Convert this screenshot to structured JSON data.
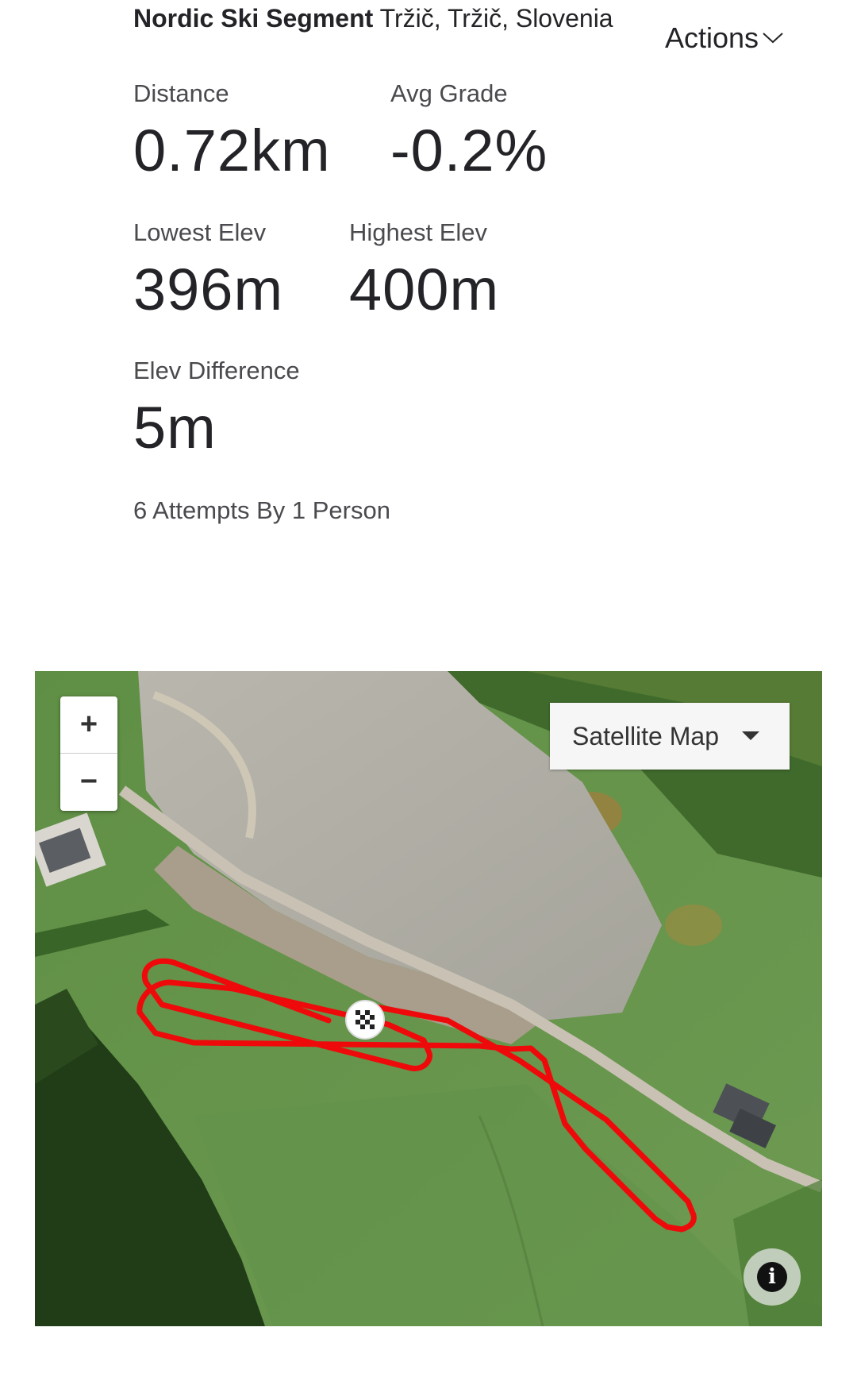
{
  "header": {
    "segment_name": "Nordic Ski Segment",
    "location": "Tržič, Tržič, Slovenia",
    "actions_label": "Actions",
    "actions_icon": "chevron-down-icon"
  },
  "stats": {
    "distance": {
      "label": "Distance",
      "value": "0.72km"
    },
    "avg_grade": {
      "label": "Avg Grade",
      "value": "-0.2%"
    },
    "lowest_elev": {
      "label": "Lowest Elev",
      "value": "396m"
    },
    "highest_elev": {
      "label": "Highest Elev",
      "value": "400m"
    },
    "elev_difference": {
      "label": "Elev Difference",
      "value": "5m"
    }
  },
  "attempts_text": "6 Attempts By 1 Person",
  "map": {
    "zoom_in_label": "+",
    "zoom_out_label": "−",
    "map_type_label": "Satellite Map",
    "map_type_icon": "caret-down-icon",
    "info_icon": "info-icon",
    "info_glyph": "i",
    "start_marker_icon": "checkered-flag-icon",
    "route_color": "#ee0a0a"
  }
}
